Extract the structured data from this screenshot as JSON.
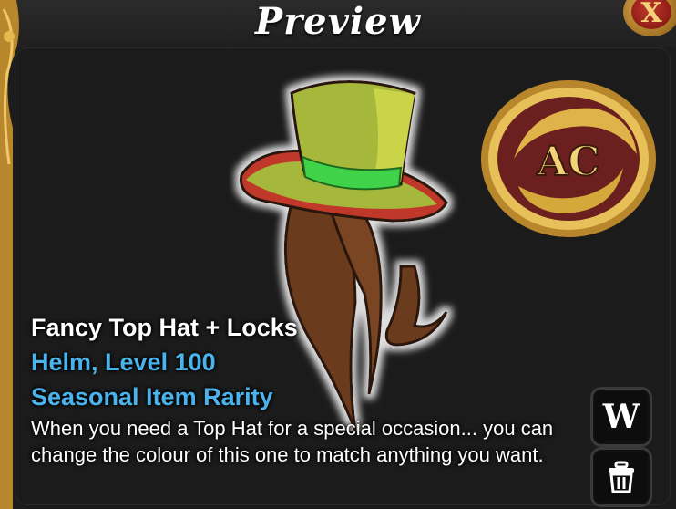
{
  "window": {
    "title": "Preview",
    "close_label": "X"
  },
  "item": {
    "name": "Fancy Top Hat + Locks",
    "type_level": "Helm, Level 100",
    "rarity": "Seasonal Item Rarity",
    "description": "When you need a Top Hat for a special occasion... you can change the colour of this one to match anything you want.",
    "currency_badge_text": "AC"
  },
  "buttons": {
    "wiki_label": "W",
    "delete_icon": "trash-icon"
  },
  "colors": {
    "title_text": "#ffffff",
    "item_name": "#ffffff",
    "item_subtext": "#4ab3ec",
    "panel_bg": "#1b1b1b",
    "hat": "#a6b83a",
    "hat_band": "#3fd24a",
    "brim_trim": "#c0392b",
    "hair": "#6b3a1a",
    "coin_gold": "#d4a83a",
    "coin_red": "#6b1f1f"
  }
}
